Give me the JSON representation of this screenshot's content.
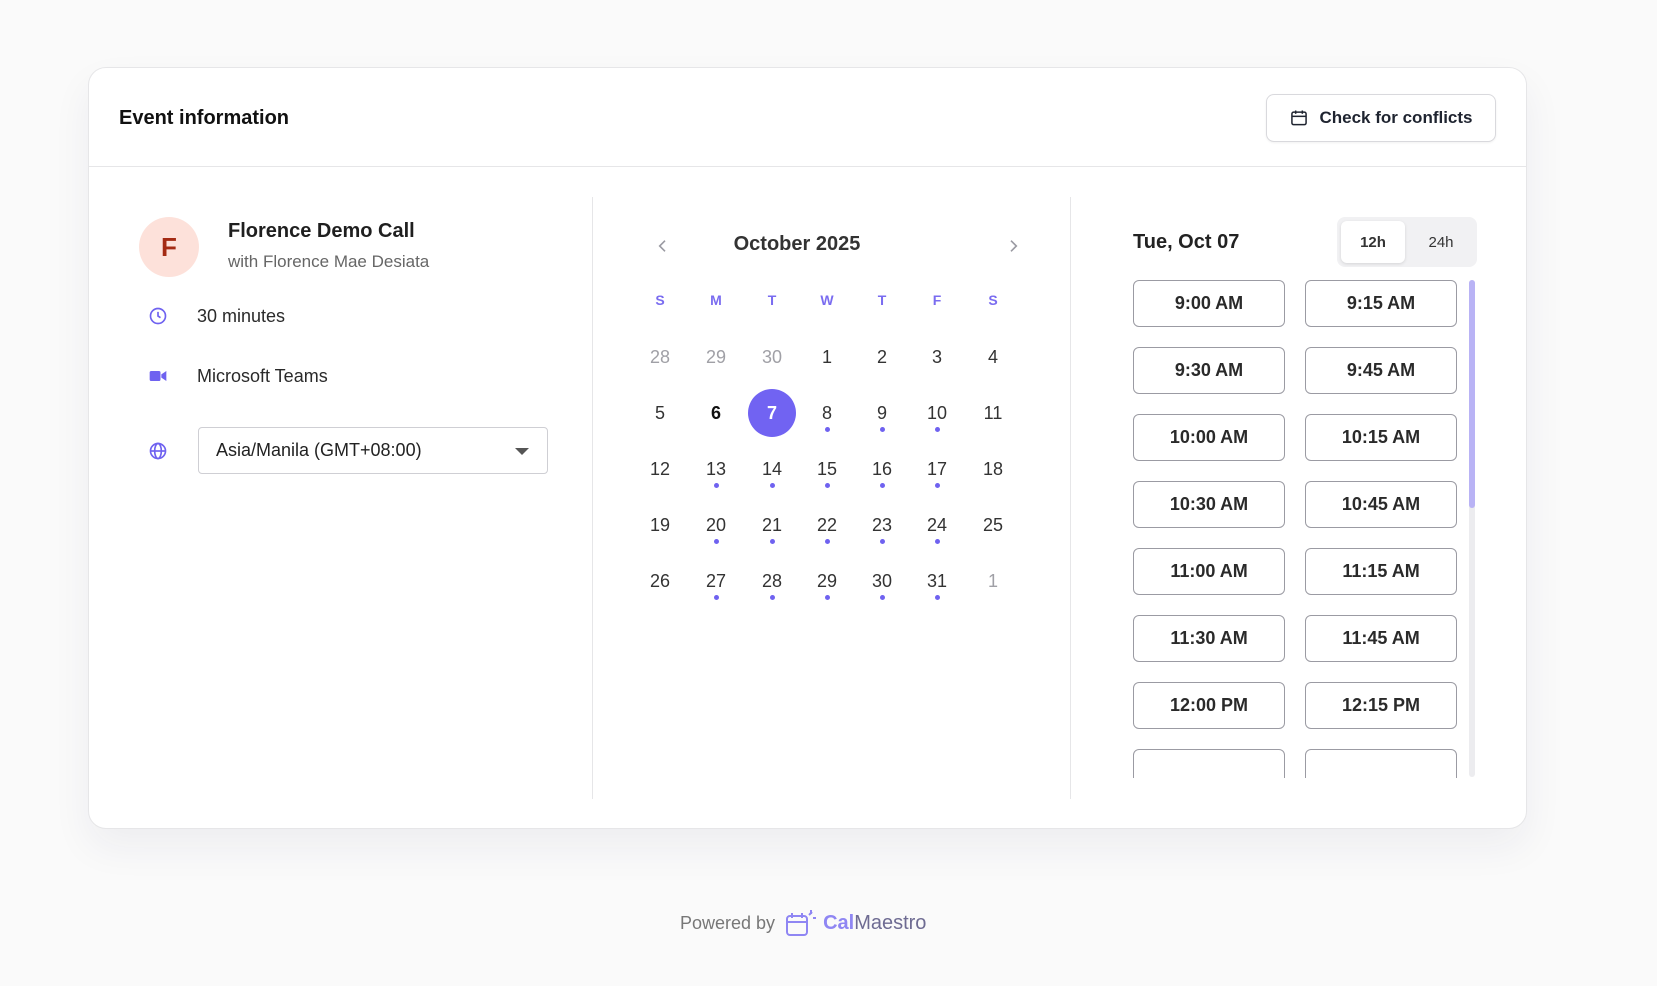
{
  "header": {
    "title": "Event information",
    "check_conflicts_label": "Check for conflicts"
  },
  "event": {
    "avatar_letter": "F",
    "name": "Florence Demo Call",
    "host": "with Florence Mae Desiata",
    "duration": "30 minutes",
    "location": "Microsoft Teams",
    "timezone": "Asia/Manila (GMT+08:00)"
  },
  "calendar": {
    "month_label": "October 2025",
    "weekdays": [
      "S",
      "M",
      "T",
      "W",
      "T",
      "F",
      "S"
    ],
    "weeks": [
      [
        {
          "d": "28",
          "muted": true
        },
        {
          "d": "29",
          "muted": true
        },
        {
          "d": "30",
          "muted": true
        },
        {
          "d": "1"
        },
        {
          "d": "2"
        },
        {
          "d": "3"
        },
        {
          "d": "4"
        }
      ],
      [
        {
          "d": "5"
        },
        {
          "d": "6",
          "bold": true
        },
        {
          "d": "7",
          "selected": true
        },
        {
          "d": "8",
          "dot": true
        },
        {
          "d": "9",
          "dot": true
        },
        {
          "d": "10",
          "dot": true
        },
        {
          "d": "11"
        }
      ],
      [
        {
          "d": "12"
        },
        {
          "d": "13",
          "dot": true
        },
        {
          "d": "14",
          "dot": true
        },
        {
          "d": "15",
          "dot": true
        },
        {
          "d": "16",
          "dot": true
        },
        {
          "d": "17",
          "dot": true
        },
        {
          "d": "18"
        }
      ],
      [
        {
          "d": "19"
        },
        {
          "d": "20",
          "dot": true
        },
        {
          "d": "21",
          "dot": true
        },
        {
          "d": "22",
          "dot": true
        },
        {
          "d": "23",
          "dot": true
        },
        {
          "d": "24",
          "dot": true
        },
        {
          "d": "25"
        }
      ],
      [
        {
          "d": "26"
        },
        {
          "d": "27",
          "dot": true
        },
        {
          "d": "28",
          "dot": true
        },
        {
          "d": "29",
          "dot": true
        },
        {
          "d": "30",
          "dot": true
        },
        {
          "d": "31",
          "dot": true
        },
        {
          "d": "1",
          "muted": true
        }
      ]
    ]
  },
  "times": {
    "date_heading": "Tue, Oct 07",
    "format_options": [
      "12h",
      "24h"
    ],
    "active_format": "12h",
    "slots": [
      "9:00 AM",
      "9:15 AM",
      "9:30 AM",
      "9:45 AM",
      "10:00 AM",
      "10:15 AM",
      "10:30 AM",
      "10:45 AM",
      "11:00 AM",
      "11:15 AM",
      "11:30 AM",
      "11:45 AM",
      "12:00 PM",
      "12:15 PM",
      "",
      ""
    ]
  },
  "footer": {
    "powered_by": "Powered by",
    "brand_part1": "Cal",
    "brand_part2": "Maestro"
  },
  "colors": {
    "accent": "#7163f2",
    "avatar_bg": "#fde1da",
    "avatar_text": "#a42a13"
  }
}
